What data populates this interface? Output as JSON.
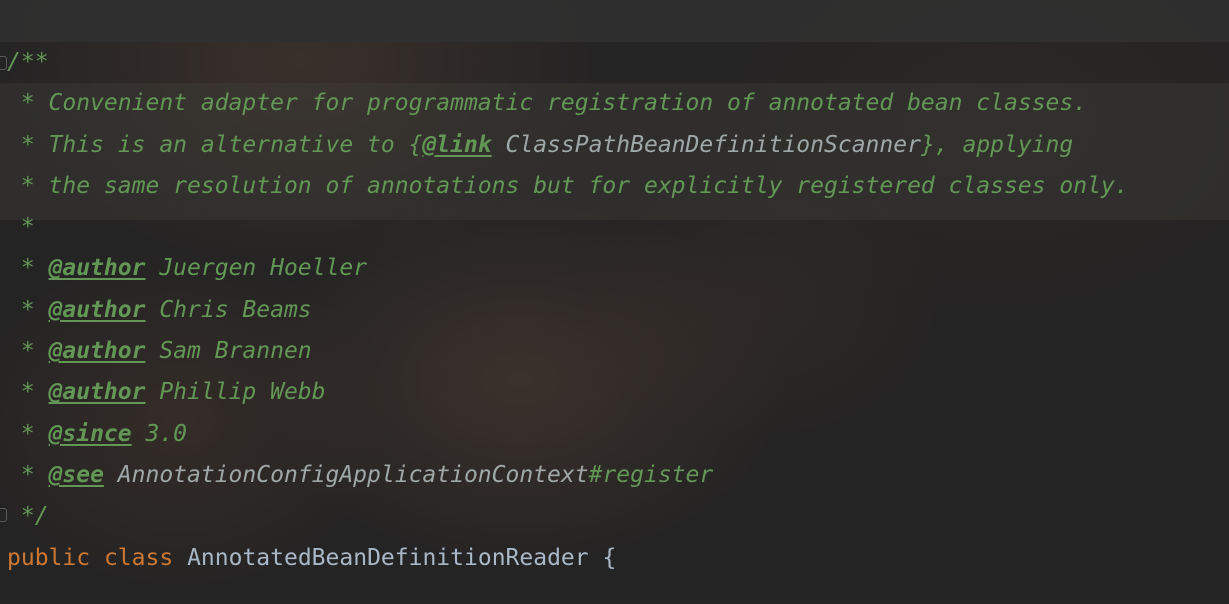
{
  "editor": {
    "doc_start": "/**",
    "desc_line_1": " * Convenient adapter for programmatic registration of annotated bean classes.",
    "desc_line_2_prefix": " * This is an alternative to {",
    "desc_line_2_link_tag": "@link",
    "desc_line_2_link_ref": " ClassPathBeanDefinitionScanner",
    "desc_line_2_suffix": "}, applying",
    "desc_line_3": " * the same resolution of annotations but for explicitly registered classes only.",
    "blank_line": " *",
    "line_prefix": " * ",
    "authors": [
      {
        "tag": "@author",
        "name": " Juergen Hoeller"
      },
      {
        "tag": "@author",
        "name": " Chris Beams"
      },
      {
        "tag": "@author",
        "name": " Sam Brannen"
      },
      {
        "tag": "@author",
        "name": " Phillip Webb"
      }
    ],
    "since_tag": "@since",
    "since_value": " 3.0",
    "see_tag": "@see",
    "see_class": " AnnotationConfigApplicationContext",
    "see_member": "#register",
    "doc_end": " */",
    "decl_public": "public",
    "decl_class": "class",
    "decl_name": "AnnotatedBeanDefinitionReader",
    "decl_brace": " {"
  },
  "colors": {
    "background": "#252424",
    "doc_comment": "#629755",
    "keyword": "#cc7832",
    "identifier": "#a9b7c6",
    "doc_reference": "#9fa7a8"
  }
}
